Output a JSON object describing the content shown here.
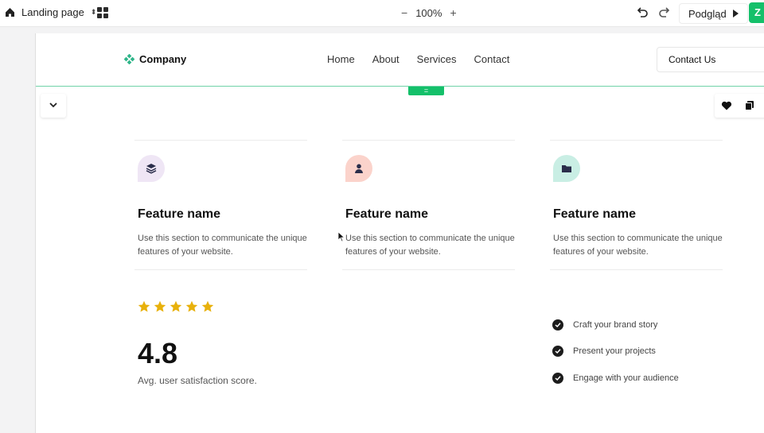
{
  "editor": {
    "page_name": "Landing page",
    "zoom_level": "100%",
    "zoom_minus": "−",
    "zoom_plus": "+",
    "preview_label": "Podgląd",
    "publish_label": "Z",
    "accent_color": "#14c06a"
  },
  "site": {
    "brand": "Company",
    "nav": [
      "Home",
      "About",
      "Services",
      "Contact"
    ],
    "contact_button": "Contact Us",
    "drag_handle": "="
  },
  "features": [
    {
      "title": "Feature name",
      "description": "Use this section to communicate the unique features of your website.",
      "icon": "layers-icon",
      "icon_bg": "#efe6f5"
    },
    {
      "title": "Feature name",
      "description": "Use this section to communicate the unique features of your website.",
      "icon": "user-icon",
      "icon_bg": "#fbd3cb"
    },
    {
      "title": "Feature name",
      "description": "Use this section to communicate the unique features of your website.",
      "icon": "folder-icon",
      "icon_bg": "#c9eee4"
    }
  ],
  "rating": {
    "stars": 5,
    "star_color": "#e8b10c",
    "score": "4.8",
    "label": "Avg. user satisfaction score."
  },
  "checklist": [
    "Craft your brand story",
    "Present your projects",
    "Engage with your audience"
  ]
}
